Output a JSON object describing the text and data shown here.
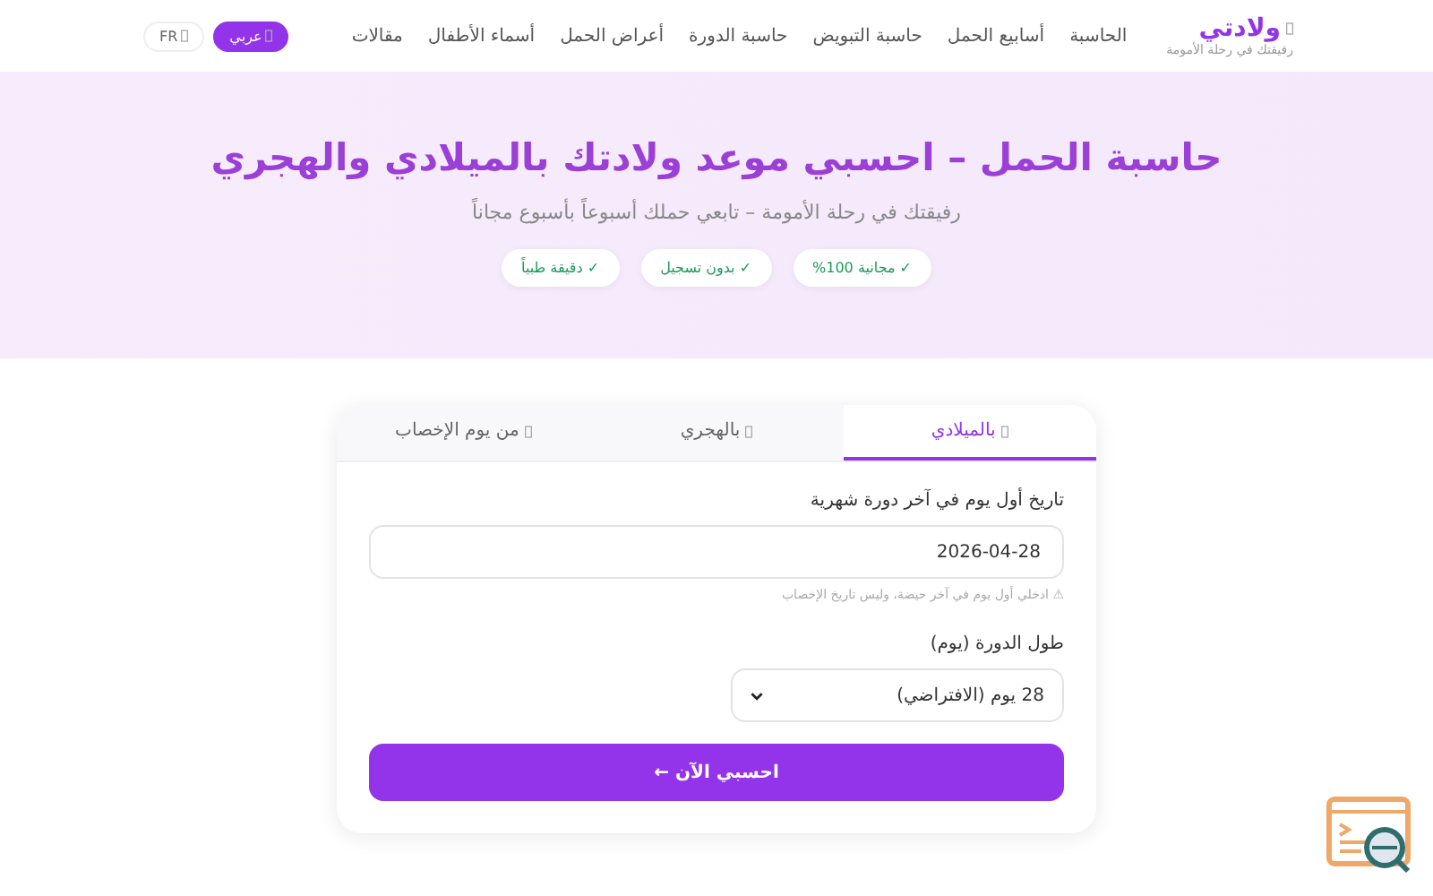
{
  "header": {
    "logo": {
      "title": "ولادتي",
      "tagline": "رفيقتك في رحلة الأمومة"
    },
    "nav": [
      "الحاسبة",
      "أسابيع الحمل",
      "حاسبة التبويض",
      "حاسبة الدورة",
      "أعراض الحمل",
      "أسماء الأطفال",
      "مقالات"
    ],
    "languages": [
      {
        "label": "عربي",
        "selected": true
      },
      {
        "label": "FR",
        "selected": false
      }
    ]
  },
  "hero": {
    "title": "حاسبة الحمل – احسبي موعد ولادتك بالميلادي والهجري",
    "subtitle": "رفيقتك في رحلة الأمومة – تابعي حملك أسبوعاً بأسبوع مجاناً",
    "badges": [
      "✓ مجانية 100%",
      "✓ بدون تسجيل",
      "✓ دقيقة طبياً"
    ]
  },
  "tabs": [
    {
      "label": "بالميلادي",
      "selected": true
    },
    {
      "label": "بالهجري",
      "selected": false
    },
    {
      "label": "من يوم الإخصاب",
      "selected": false
    }
  ],
  "form": {
    "date_label": "تاريخ أول يوم في آخر دورة شهرية",
    "date_value": "2026-04-28",
    "hint": "⚠ ادخلي أول يوم في آخر حيضة، وليس تاريخ الإخصاب",
    "cycle_label": "طول الدورة (يوم)",
    "cycle_value": "28 يوم (الافتراضي)",
    "submit": "احسبي الآن ←"
  }
}
